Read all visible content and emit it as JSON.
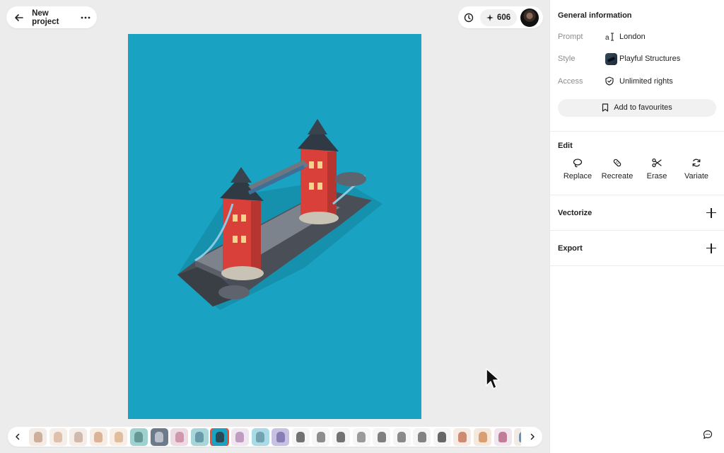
{
  "header": {
    "project_title": "New project",
    "credits": "606"
  },
  "icons": {
    "back": "arrow-left-icon",
    "more": "more-horizontal-icon",
    "history": "clock-icon",
    "credits": "sparkle-icon",
    "filmstrip_prev": "chevron-left-icon",
    "filmstrip_next": "chevron-right-icon",
    "chat": "chat-bubble-icon"
  },
  "filmstrip": {
    "thumbs": [
      {
        "bg": "#f3ece6",
        "fg": "#c7a58d"
      },
      {
        "bg": "#f6efe9",
        "fg": "#d9b9a2"
      },
      {
        "bg": "#f4ede8",
        "fg": "#c9b0a2"
      },
      {
        "bg": "#f5ede6",
        "fg": "#d6a98a"
      },
      {
        "bg": "#f6eee7",
        "fg": "#dcb48f"
      },
      {
        "bg": "#9fd1cf",
        "fg": "#5b8f8c"
      },
      {
        "bg": "#6c7a8c",
        "fg": "#c8ccd3"
      },
      {
        "bg": "#eddbe3",
        "fg": "#c98ba1"
      },
      {
        "bg": "#a8d6d8",
        "fg": "#5e8fa1"
      },
      {
        "bg": "#1aa2c2",
        "fg": "#2b3b44",
        "active": true
      },
      {
        "bg": "#efe6f0",
        "fg": "#b58fb9"
      },
      {
        "bg": "#a9dbe6",
        "fg": "#6c98a6"
      },
      {
        "bg": "#c9c1e2",
        "fg": "#7d72ad"
      },
      {
        "bg": "#f5f5f5",
        "fg": "#5a5a5a"
      },
      {
        "bg": "#f7f7f7",
        "fg": "#7a7a7a"
      },
      {
        "bg": "#f5f5f5",
        "fg": "#5c5c5c"
      },
      {
        "bg": "#f7f7f7",
        "fg": "#8a8a8a"
      },
      {
        "bg": "#f6f6f6",
        "fg": "#6a6a6a"
      },
      {
        "bg": "#f6f6f6",
        "fg": "#777777"
      },
      {
        "bg": "#f5f5f5",
        "fg": "#6e6e6e"
      },
      {
        "bg": "#f6f6f6",
        "fg": "#4e4e4e"
      },
      {
        "bg": "#f7ece4",
        "fg": "#c77a5e"
      },
      {
        "bg": "#f5e9de",
        "fg": "#d59060"
      },
      {
        "bg": "#f2e6ee",
        "fg": "#b86a86"
      },
      {
        "bg": "#f3ebe3",
        "fg": "#5a7fa8"
      }
    ]
  },
  "panel": {
    "general": {
      "title": "General information",
      "rows": [
        {
          "label": "Prompt",
          "value": "London",
          "icon": "text-cursor-icon"
        },
        {
          "label": "Style",
          "value": "Playful Structures",
          "icon": "style-thumbnail"
        },
        {
          "label": "Access",
          "value": "Unlimited rights",
          "icon": "shield-check-icon"
        }
      ],
      "favourite_label": "Add to favourites"
    },
    "edit": {
      "title": "Edit",
      "tools": [
        {
          "label": "Replace",
          "icon": "lasso-icon"
        },
        {
          "label": "Recreate",
          "icon": "bandage-icon"
        },
        {
          "label": "Erase",
          "icon": "scissors-icon"
        },
        {
          "label": "Variate",
          "icon": "refresh-icon"
        }
      ]
    },
    "vectorize": {
      "title": "Vectorize"
    },
    "export": {
      "title": "Export"
    }
  },
  "colors": {
    "canvas_bg": "#ececec",
    "image_bg": "#1aa2c2",
    "tower_red": "#d9403a",
    "active_outline": "#e2533b"
  }
}
